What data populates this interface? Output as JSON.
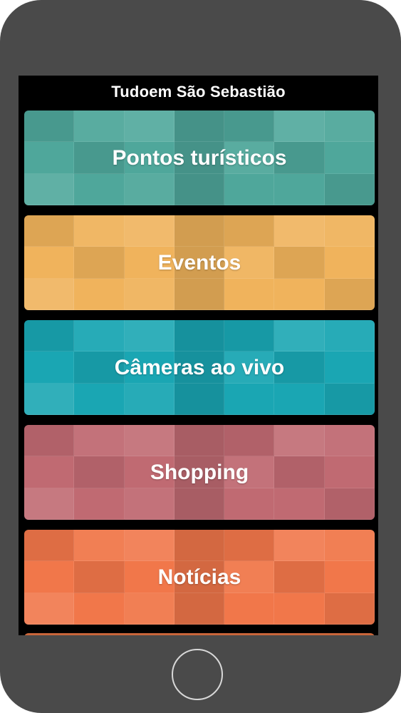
{
  "app": {
    "title": "Tudoem São Sebastião"
  },
  "menu": {
    "items": [
      {
        "label": "Pontos turísticos",
        "color": "#4fa79b"
      },
      {
        "label": "Eventos",
        "color": "#f0b35c"
      },
      {
        "label": "Câmeras ao vivo",
        "color": "#1aa6b3"
      },
      {
        "label": "Shopping",
        "color": "#c06a72"
      },
      {
        "label": "Notícias",
        "color": "#f1774a"
      }
    ]
  },
  "device": {
    "frame_color": "#4a4a4a",
    "screen_color": "#000000"
  }
}
